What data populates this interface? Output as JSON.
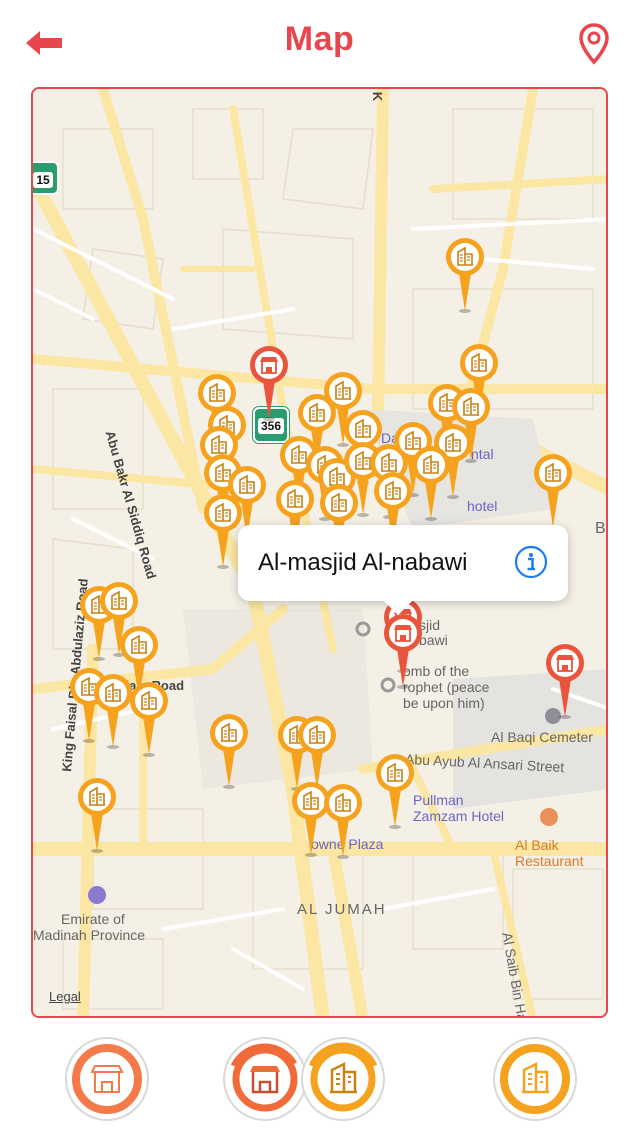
{
  "header": {
    "title": "Map",
    "back_icon": "arrow-left-icon",
    "location_icon": "map-pin-icon",
    "accent_color": "#e8454c"
  },
  "map": {
    "roads": {
      "abu_bakr": "Abu Bakr Al Siddiq Road",
      "king_faisal": "King Faisal Bin Abdulaziz Road",
      "al_salam": "Al Salam Road",
      "abu_ayub": "Abu Ayub Al Ansari Street",
      "al_saib": "Al Saib Bin Hal"
    },
    "shields": {
      "route_356": "356",
      "route_15": "15"
    },
    "places": {
      "dar_al": "Dar Al",
      "dar_al_2": "ntal",
      "hotel": "hotel",
      "masjid_line1": "sjid",
      "masjid_line2": "bawi",
      "tomb_line1": "omb of the",
      "tomb_line2": "rophet (peace",
      "tomb_line3": "be upon him)",
      "al_baqi": "Al Baqi Cemeter",
      "pullman_line1": "Pullman",
      "pullman_line2": "Zamzam Hotel",
      "towne": "owne Plaza",
      "al_baik_line1": "Al Baik",
      "al_baik_line2": "Restaurant",
      "emirate_line1": "Emirate of",
      "emirate_line2": "Madinah Province",
      "b_edge": "B",
      "k_edge": "K"
    },
    "district": "AL JUMAH",
    "legal": "Legal",
    "callout": {
      "title": "Al-masjid Al-nabawi",
      "info_icon": "info-icon"
    },
    "pin_colors": {
      "hotel": "#f5a21f",
      "market": "#e8553c"
    }
  },
  "tabs": [
    {
      "name": "markets",
      "icon": "storefront-icon",
      "color": "#f47a4a"
    },
    {
      "name": "markets-hotels",
      "icon": "storefront-icon",
      "color": "#f06a3a"
    },
    {
      "name": "hotels-alt",
      "icon": "building-icon",
      "color": "#f5a21f"
    },
    {
      "name": "hotels",
      "icon": "building-icon",
      "color": "#f5a21f"
    }
  ]
}
